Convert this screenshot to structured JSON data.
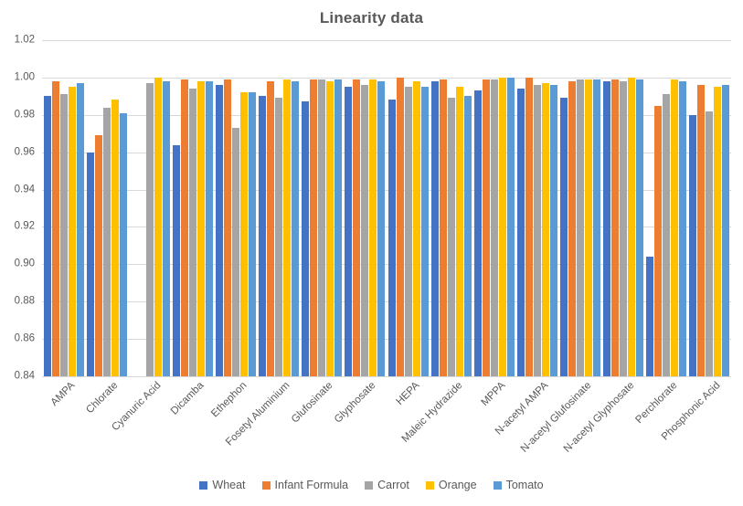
{
  "chart_data": {
    "type": "bar",
    "title": "Linearity data",
    "xlabel": "",
    "ylabel": "",
    "ylim": [
      0.84,
      1.02
    ],
    "ytick_step": 0.02,
    "ytick_labels": [
      "1.02",
      "1.00",
      "0.98",
      "0.96",
      "0.94",
      "0.92",
      "0.90",
      "0.88",
      "0.86",
      "0.84"
    ],
    "ytick_values": [
      1.02,
      1.0,
      0.98,
      0.96,
      0.94,
      0.92,
      0.9,
      0.88,
      0.86,
      0.84
    ],
    "grid": true,
    "legend_position": "bottom",
    "categories": [
      "AMPA",
      "Chlorate",
      "Cyanuric Acid",
      "Dicamba",
      "Ethephon",
      "Fosetyl Aluminium",
      "Glufosinate",
      "Glyphosate",
      "HEPA",
      "Maleic Hydrazide",
      "MPPA",
      "N-acetyl AMPA",
      "N-acetyl Glufosinate",
      "N-acetyl Glyphosate",
      "Perchlorate",
      "Phosphonic Acid"
    ],
    "series": [
      {
        "name": "Wheat",
        "color": "#4472C4",
        "values": [
          0.99,
          0.96,
          null,
          0.964,
          0.996,
          0.99,
          0.987,
          0.995,
          0.988,
          0.998,
          0.993,
          0.994,
          0.989,
          0.998,
          0.904,
          0.98
        ]
      },
      {
        "name": "Infant Formula",
        "color": "#ED7D31",
        "values": [
          0.998,
          0.969,
          null,
          0.999,
          0.999,
          0.998,
          0.999,
          0.999,
          1.0,
          0.999,
          0.999,
          1.0,
          0.998,
          0.999,
          0.985,
          0.996
        ]
      },
      {
        "name": "Carrot",
        "color": "#A5A5A5",
        "values": [
          0.991,
          0.984,
          0.997,
          0.994,
          0.973,
          0.989,
          0.999,
          0.996,
          0.995,
          0.989,
          0.999,
          0.996,
          0.999,
          0.998,
          0.991,
          0.982
        ]
      },
      {
        "name": "Orange",
        "color": "#FFC000",
        "values": [
          0.995,
          0.988,
          1.0,
          0.998,
          0.992,
          0.999,
          0.998,
          0.999,
          0.998,
          0.995,
          1.0,
          0.997,
          0.999,
          1.0,
          0.999,
          0.995
        ]
      },
      {
        "name": "Tomato",
        "color": "#5B9BD5",
        "values": [
          0.997,
          0.981,
          0.998,
          0.998,
          0.992,
          0.998,
          0.999,
          0.998,
          0.995,
          0.99,
          1.0,
          0.996,
          0.999,
          0.999,
          0.998,
          0.996
        ]
      }
    ]
  },
  "legend": {
    "items": [
      {
        "label": "Wheat",
        "color": "#4472C4"
      },
      {
        "label": "Infant Formula",
        "color": "#ED7D31"
      },
      {
        "label": "Carrot",
        "color": "#A5A5A5"
      },
      {
        "label": "Orange",
        "color": "#FFC000"
      },
      {
        "label": "Tomato",
        "color": "#5B9BD5"
      }
    ]
  }
}
